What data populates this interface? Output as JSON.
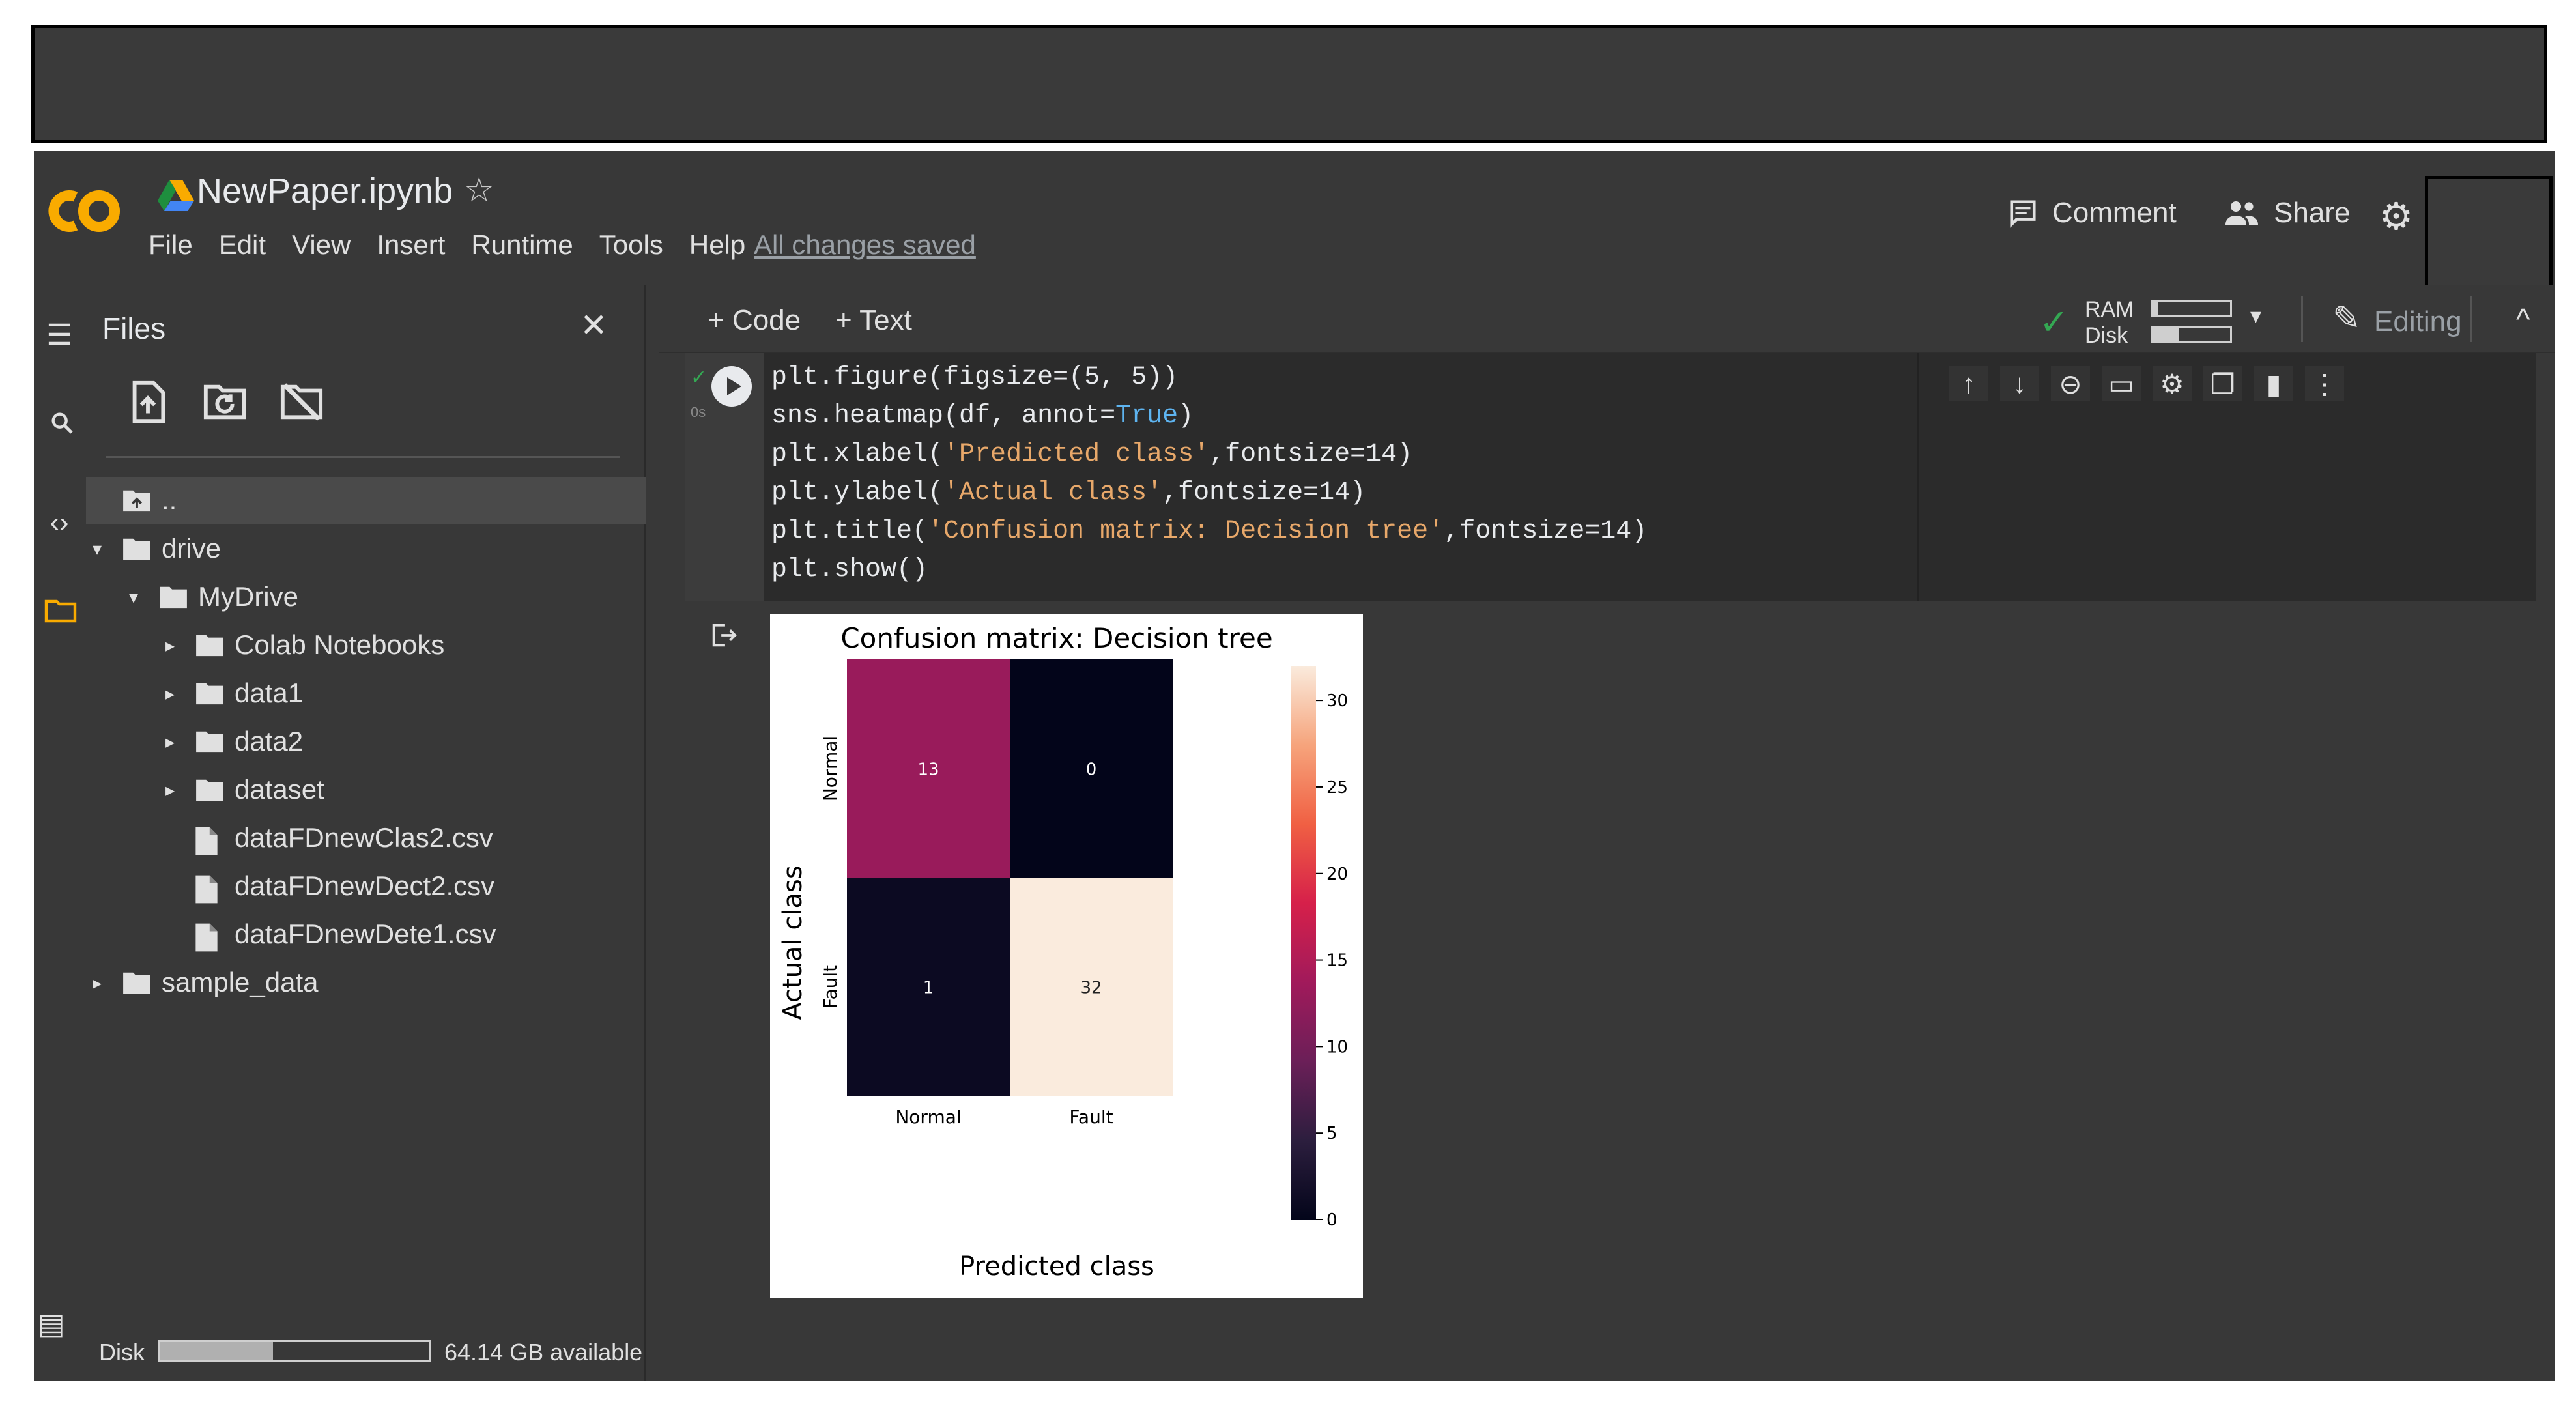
{
  "header": {
    "title": "NewPaper.ipynb",
    "menu": [
      "File",
      "Edit",
      "View",
      "Insert",
      "Runtime",
      "Tools",
      "Help"
    ],
    "save_status": "All changes saved",
    "comment_label": "Comment",
    "share_label": "Share"
  },
  "toolbar": {
    "add_code": "+ Code",
    "add_text": "+ Text",
    "ram_label": "RAM",
    "disk_label": "Disk",
    "editing_label": "Editing"
  },
  "sidebar": {
    "title": "Files",
    "tree": [
      {
        "label": "..",
        "level": 0,
        "kind": "up",
        "selected": true
      },
      {
        "label": "drive",
        "level": 0,
        "kind": "folder",
        "expanded": true
      },
      {
        "label": "MyDrive",
        "level": 1,
        "kind": "folder",
        "expanded": true
      },
      {
        "label": "Colab Notebooks",
        "level": 2,
        "kind": "folder",
        "expanded": false
      },
      {
        "label": "data1",
        "level": 2,
        "kind": "folder",
        "expanded": false
      },
      {
        "label": "data2",
        "level": 2,
        "kind": "folder",
        "expanded": false
      },
      {
        "label": "dataset",
        "level": 2,
        "kind": "folder",
        "expanded": false
      },
      {
        "label": "dataFDnewClas2.csv",
        "level": 2,
        "kind": "file"
      },
      {
        "label": "dataFDnewDect2.csv",
        "level": 2,
        "kind": "file"
      },
      {
        "label": "dataFDnewDete1.csv",
        "level": 2,
        "kind": "file"
      },
      {
        "label": "sample_data",
        "level": 0,
        "kind": "folder",
        "expanded": false
      }
    ],
    "disk_label": "Disk",
    "disk_available": "64.14 GB available",
    "disk_fraction": 0.42
  },
  "cell": {
    "status": "0s",
    "code_lines": [
      [
        {
          "t": "plt.figure(figsize=(5, 5))"
        }
      ],
      [
        {
          "t": "sns.heatmap(df, annot="
        },
        {
          "t": "True",
          "c": "k"
        },
        {
          "t": ")"
        }
      ],
      [
        {
          "t": "plt.xlabel("
        },
        {
          "t": "'Predicted class'",
          "c": "s"
        },
        {
          "t": ",fontsize=14)"
        }
      ],
      [
        {
          "t": "plt.ylabel("
        },
        {
          "t": "'Actual class'",
          "c": "s"
        },
        {
          "t": ",fontsize=14)"
        }
      ],
      [
        {
          "t": "plt.title("
        },
        {
          "t": "'Confusion matrix: Decision tree'",
          "c": "s"
        },
        {
          "t": ",fontsize=14)"
        }
      ],
      [
        {
          "t": "plt.show()"
        }
      ]
    ]
  },
  "chart_data": {
    "type": "heatmap",
    "title": "Confusion matrix: Decision tree",
    "xlabel": "Predicted class",
    "ylabel": "Actual class",
    "x_categories": [
      "Normal",
      "Fault"
    ],
    "y_categories": [
      "Normal",
      "Fault"
    ],
    "values": [
      [
        13,
        0
      ],
      [
        1,
        32
      ]
    ],
    "colorbar": {
      "min": 0,
      "max": 32,
      "ticks": [
        0,
        5,
        10,
        15,
        20,
        25,
        30
      ]
    },
    "colormap": [
      "#03051a",
      "#2c1e3e",
      "#6b1f58",
      "#a11a5b",
      "#d6204a",
      "#f06043",
      "#f6a47c",
      "#faebdd"
    ]
  }
}
